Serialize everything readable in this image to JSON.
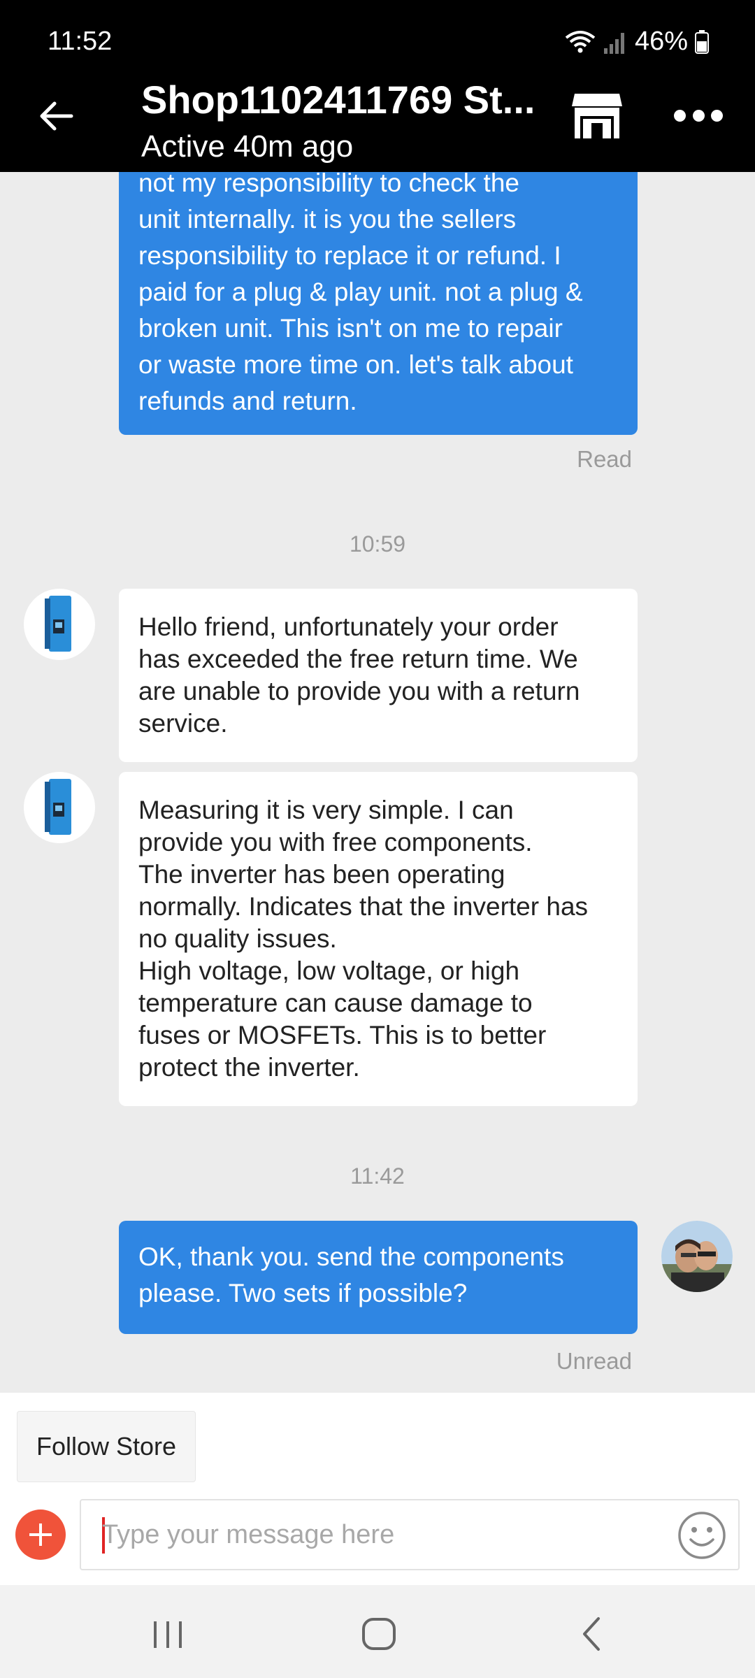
{
  "status_bar": {
    "time": "11:52",
    "battery": "46%"
  },
  "header": {
    "title": "Shop1102411769 St...",
    "subtitle": "Active 40m ago"
  },
  "messages": [
    {
      "id": "m1",
      "side": "out",
      "text": "not my responsibility to check the\nunit internally.  it is you the sellers\nresponsibility to replace it or refund. I\npaid for a plug & play unit. not a plug &\nbroken unit. This isn't on me to repair\nor waste more time on. let's talk about\nrefunds and return.",
      "receipt": "Read"
    },
    {
      "id": "t1",
      "type": "timestamp",
      "text": "10:59"
    },
    {
      "id": "m2",
      "side": "in",
      "text": "Hello friend, unfortunately your order\nhas exceeded the free return time. We\nare unable to provide you with a return\nservice."
    },
    {
      "id": "m3",
      "side": "in",
      "text": "Measuring it is very simple. I can\nprovide you with free components.\nThe inverter has been operating\nnormally. Indicates that the inverter has\nno quality issues.\nHigh voltage, low voltage, or high\ntemperature can cause damage to\nfuses or MOSFETs. This is to better\nprotect the inverter."
    },
    {
      "id": "t2",
      "type": "timestamp",
      "text": "11:42"
    },
    {
      "id": "m4",
      "side": "out",
      "text": "OK, thank you. send the components\nplease. Two sets if possible?",
      "receipt": "Unread"
    }
  ],
  "bottom": {
    "follow_label": "Follow Store",
    "input_placeholder": "Type your message here"
  },
  "colors": {
    "outgoing_bubble": "#2f86e3",
    "incoming_bubble": "#ffffff",
    "chat_background": "#ececec",
    "accent_plus": "#f0533a"
  },
  "icons": {
    "back": "arrow-left-icon",
    "store": "store-icon",
    "more": "more-dots-icon",
    "plus": "plus-icon",
    "emoji": "smiley-icon"
  }
}
